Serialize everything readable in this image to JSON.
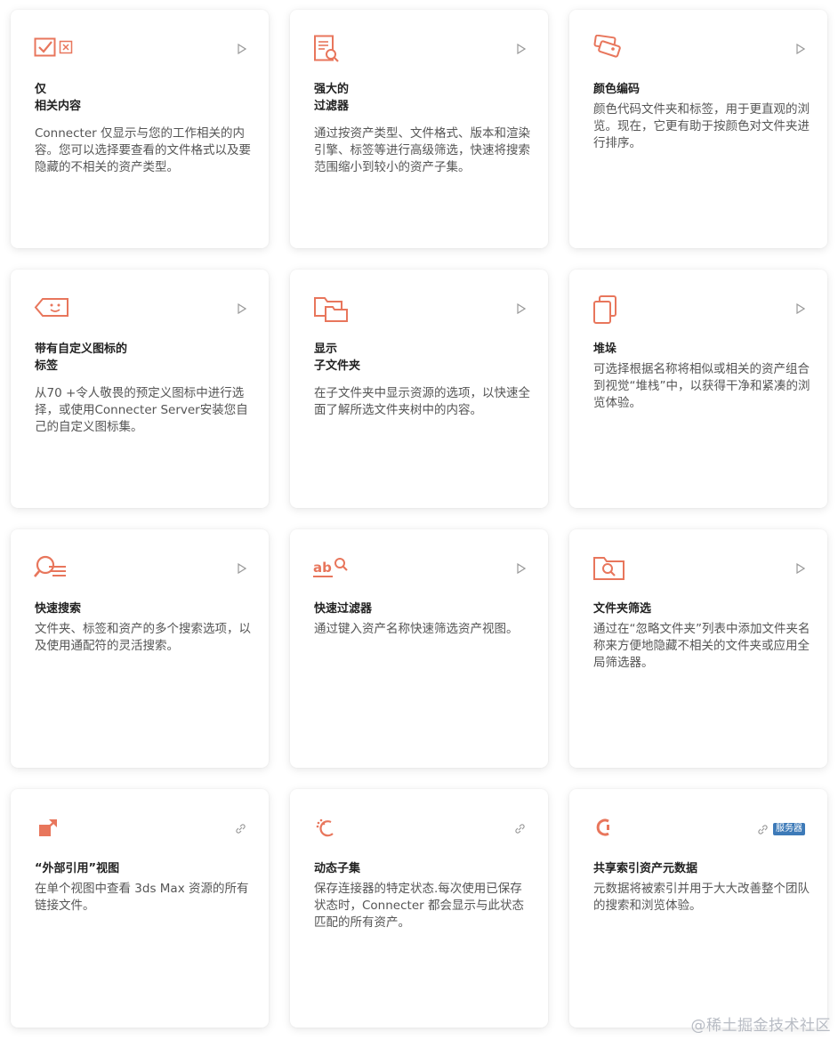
{
  "cards": [
    {
      "title": [
        "仅",
        "相关内容"
      ],
      "desc": "Connecter 仅显示与您的工作相关的内容。您可以选择要查看的文件格式以及要隐藏的不相关的资产类型。",
      "icon": "check-box-icon",
      "corner": "play-icon"
    },
    {
      "title": [
        "强大的",
        "过滤器"
      ],
      "desc": "通过按资产类型、文件格式、版本和渲染引擎、标签等进行高级筛选，快速将搜索范围缩小到较小的资产子集。",
      "icon": "document-search-icon",
      "corner": "play-icon"
    },
    {
      "title": [
        "颜色编码"
      ],
      "desc": "颜色代码文件夹和标签，用于更直观的浏览。现在，它更有助于按颜色对文件夹进行排序。",
      "icon": "color-tags-icon",
      "corner": "play-icon"
    },
    {
      "title": [
        "带有自定义图标的",
        "标签"
      ],
      "desc": "从70 +令人敬畏的预定义图标中进行选择，或使用Connecter Server安装您自己的自定义图标集。",
      "icon": "tag-icon",
      "corner": "play-icon"
    },
    {
      "title": [
        "显示",
        "子文件夹"
      ],
      "desc": "在子文件夹中显示资源的选项，以快速全面了解所选文件夹树中的内容。",
      "icon": "subfolder-icon",
      "corner": "play-icon"
    },
    {
      "title": [
        "堆垛"
      ],
      "desc": "可选择根据名称将相似或相关的资产组合到视觉“堆栈”中，以获得干净和紧凑的浏览体验。",
      "icon": "stack-icon",
      "corner": "play-icon"
    },
    {
      "title": [
        "快速搜索"
      ],
      "desc": "文件夹、标签和资产的多个搜索选项，以及使用通配符的灵活搜索。",
      "icon": "quick-search-icon",
      "corner": "play-icon"
    },
    {
      "title": [
        "快速过滤器"
      ],
      "desc": "通过键入资产名称快速筛选资产视图。",
      "icon": "ab-search-icon",
      "corner": "play-icon"
    },
    {
      "title": [
        "文件夹筛选"
      ],
      "desc": "通过在“忽略文件夹”列表中添加文件夹名称来方便地隐藏不相关的文件夹或应用全局筛选器。",
      "icon": "folder-search-icon",
      "corner": "play-icon"
    },
    {
      "title": [
        "“外部引用”视图"
      ],
      "desc": "在单个视图中查看 3ds Max 资源的所有链接文件。",
      "icon": "external-ref-icon",
      "corner": "link-icon"
    },
    {
      "title": [
        "动态子集"
      ],
      "desc": "保存连接器的特定状态.每次使用已保存状态时，Connecter 都会显示与此状态匹配的所有资产。",
      "icon": "dynamic-subset-icon",
      "corner": "link-icon"
    },
    {
      "title": [
        "共享索引资产元数据"
      ],
      "desc": "元数据将被索引并用于大大改善整个团队的搜索和浏览体验。",
      "icon": "shared-index-icon",
      "corner": "link-icon",
      "badge": "服务器"
    }
  ],
  "watermark": "@稀土掘金技术社区",
  "colors": {
    "accent": "#e8765c",
    "badge": "#3d7ab8"
  }
}
